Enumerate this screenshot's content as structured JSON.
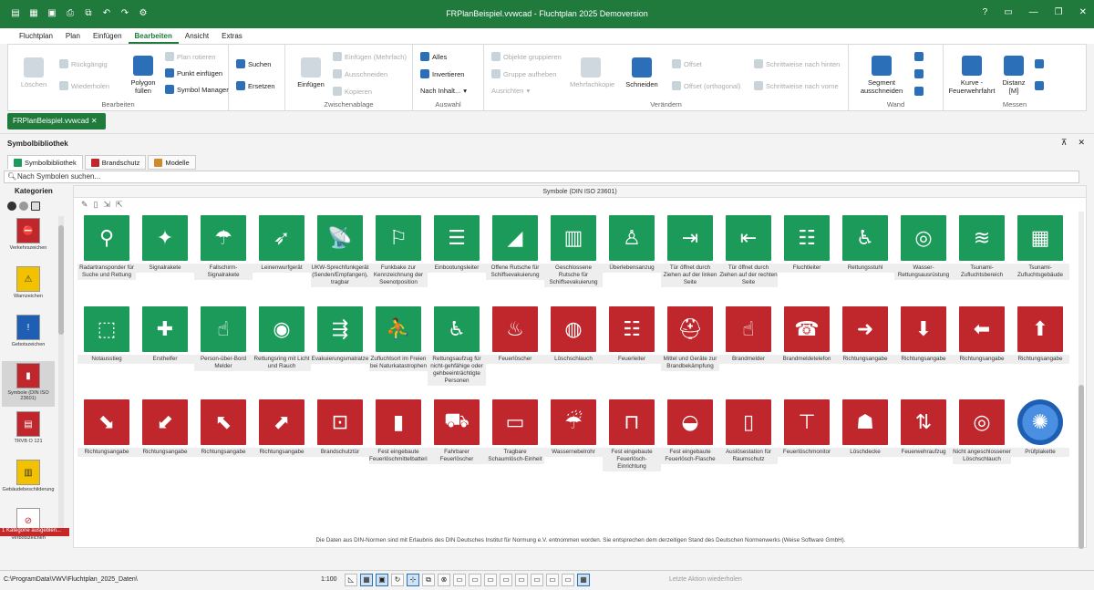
{
  "window": {
    "title": "FRPlanBeispiel.vvwcad - Fluchtplan 2025 Demoversion"
  },
  "menu": [
    "Fluchtplan",
    "Plan",
    "Einfügen",
    "Bearbeiten",
    "Ansicht",
    "Extras"
  ],
  "menu_active": "Bearbeiten",
  "ribbon": {
    "delete": "Löschen",
    "undo": "Rückgängig",
    "redo": "Wiederholen",
    "polygon": "Polygon füllen",
    "plan_rotate": "Plan rotieren",
    "point_insert": "Punkt einfügen",
    "symbol_manager": "Symbol Manager",
    "group_bearbeiten": "Bearbeiten",
    "search": "Suchen",
    "replace": "Ersetzen",
    "paste": "Einfügen",
    "paste_multi": "Einfügen (Mehrfach)",
    "cut": "Ausschneiden",
    "copy": "Kopieren",
    "group_clip": "Zwischenablage",
    "all": "Alles",
    "invert": "Invertieren",
    "by_content": "Nach Inhalt...",
    "group_select": "Auswahl",
    "group_objects": "Objekte gruppieren",
    "ungroup": "Gruppe aufheben",
    "align": "Ausrichten",
    "multi_copy": "Mehrfachkopie",
    "trim": "Schneiden",
    "offset": "Offset",
    "offset_orth": "Offset (orthogonal)",
    "step_back": "Schrittweise nach hinten",
    "step_front": "Schrittweise nach vorne",
    "group_change": "Verändern",
    "segment_cut": "Segment ausschneiden",
    "group_wall": "Wand",
    "curve": "Kurve - Feuerwehrfahrt",
    "distance": "Distanz [M]",
    "group_measure": "Messen"
  },
  "doc_tab": "FRPlanBeispiel.vvwcad",
  "panel": {
    "title": "Symbolbibliothek",
    "tabs": [
      "Symbolbibliothek",
      "Brandschutz",
      "Modelle"
    ],
    "search_placeholder": "Nach Symbolen suchen..."
  },
  "categories": {
    "heading": "Kategorien",
    "items": [
      "Verkehrszeichen",
      "Warnzeichen",
      "Gebotszeichen",
      "Symbole (DIN ISO 23601)",
      "TRVB O 121",
      "Gebäudebeschilderung",
      "Verbotszeichen"
    ],
    "selected": "Symbole (DIN ISO 23601)",
    "hidden_note": "1 Kategorie ausgeblen..."
  },
  "main_header": "Symbole (DIN ISO 23601)",
  "symbols": [
    {
      "label": "Radartransponder für Suche und Rettung",
      "color": "g",
      "glyph": "⚲"
    },
    {
      "label": "Signalrakete",
      "color": "g",
      "glyph": "✦"
    },
    {
      "label": "Fallschirm-Signalrakete",
      "color": "g",
      "glyph": "☂"
    },
    {
      "label": "Leinenwurfgerät",
      "color": "g",
      "glyph": "➶"
    },
    {
      "label": "UKW-Sprechfunkgerät (Senden/Empfangen), tragbar",
      "color": "g",
      "glyph": "📡"
    },
    {
      "label": "Funkbake zur Kennzeichnung der Seenotposition",
      "color": "g",
      "glyph": "⚐"
    },
    {
      "label": "Einbootungsleiter",
      "color": "g",
      "glyph": "☰"
    },
    {
      "label": "Offene Rutsche für Schiffsevakuierung",
      "color": "g",
      "glyph": "◢"
    },
    {
      "label": "Geschlossene Rutsche für Schiffsevakuierung",
      "color": "g",
      "glyph": "▥"
    },
    {
      "label": "Überlebensanzug",
      "color": "g",
      "glyph": "♙"
    },
    {
      "label": "Tür öffnet durch Ziehen auf der linken Seite",
      "color": "g",
      "glyph": "⇥"
    },
    {
      "label": "Tür öffnet durch Ziehen auf der rechten Seite",
      "color": "g",
      "glyph": "⇤"
    },
    {
      "label": "Fluchtleiter",
      "color": "g",
      "glyph": "☷"
    },
    {
      "label": "Rettungsstuhl",
      "color": "g",
      "glyph": "♿"
    },
    {
      "label": "Wasser-Rettungsausrüstung",
      "color": "g",
      "glyph": "◎"
    },
    {
      "label": "Tsunami-Zufluchtsbereich",
      "color": "g",
      "glyph": "≋"
    },
    {
      "label": "Tsunami-Zufluchtsgebäude",
      "color": "g",
      "glyph": "▦"
    },
    {
      "label": "Notausstieg",
      "color": "g",
      "glyph": "⬚"
    },
    {
      "label": "Ersthelfer",
      "color": "g",
      "glyph": "✚"
    },
    {
      "label": "Person-über-Bord Melder",
      "color": "g",
      "glyph": "☝"
    },
    {
      "label": "Rettungsring mit Licht und Rauch",
      "color": "g",
      "glyph": "◉"
    },
    {
      "label": "Evakuierungsmatratze",
      "color": "g",
      "glyph": "⇶"
    },
    {
      "label": "Zufluchtsort im Freien bei Naturkatastrophen",
      "color": "g",
      "glyph": "⛹"
    },
    {
      "label": "Rettungsaufzug für nicht-gehfähige oder gehbeeinträchtigte Personen",
      "color": "g",
      "glyph": "♿"
    },
    {
      "label": "Feuerlöscher",
      "color": "r",
      "glyph": "♨"
    },
    {
      "label": "Löschschlauch",
      "color": "r",
      "glyph": "◍"
    },
    {
      "label": "Feuerleiter",
      "color": "r",
      "glyph": "☷"
    },
    {
      "label": "Mittel und Geräte zur Brandbekämpfung",
      "color": "r",
      "glyph": "⛑"
    },
    {
      "label": "Brandmelder",
      "color": "r",
      "glyph": "☝"
    },
    {
      "label": "Brandmeldetelefon",
      "color": "r",
      "glyph": "☎"
    },
    {
      "label": "Richtungsangabe",
      "color": "r",
      "glyph": "➜"
    },
    {
      "label": "Richtungsangabe",
      "color": "r",
      "glyph": "⬇"
    },
    {
      "label": "Richtungsangabe",
      "color": "r",
      "glyph": "⬅"
    },
    {
      "label": "Richtungsangabe",
      "color": "r",
      "glyph": "⬆"
    },
    {
      "label": "Richtungsangabe",
      "color": "r",
      "glyph": "⬊"
    },
    {
      "label": "Richtungsangabe",
      "color": "r",
      "glyph": "⬋"
    },
    {
      "label": "Richtungsangabe",
      "color": "r",
      "glyph": "⬉"
    },
    {
      "label": "Richtungsangabe",
      "color": "r",
      "glyph": "⬈"
    },
    {
      "label": "Brandschutztür",
      "color": "r",
      "glyph": "⊡"
    },
    {
      "label": "Fest eingebaute Feuerlöschmittelbatterie",
      "color": "r",
      "glyph": "▮"
    },
    {
      "label": "Fahrbarer Feuerlöscher",
      "color": "r",
      "glyph": "⛟"
    },
    {
      "label": "Tragbare Schaumlösch-Einheit",
      "color": "r",
      "glyph": "▭"
    },
    {
      "label": "Wassernebelrohr",
      "color": "r",
      "glyph": "☔"
    },
    {
      "label": "Fest eingebaute Feuerlösch-Einrichtung",
      "color": "r",
      "glyph": "⊓"
    },
    {
      "label": "Fest eingebaute Feuerlösch-Flasche",
      "color": "r",
      "glyph": "◒"
    },
    {
      "label": "Auslösestation für Raumschutz",
      "color": "r",
      "glyph": "▯"
    },
    {
      "label": "Feuerlöschmonitor",
      "color": "r",
      "glyph": "⊤"
    },
    {
      "label": "Löschdecke",
      "color": "r",
      "glyph": "☗"
    },
    {
      "label": "Feuerwehraufzug",
      "color": "r",
      "glyph": "⇅"
    },
    {
      "label": "Nicht angeschlossener Löschschlauch",
      "color": "r",
      "glyph": "◎"
    },
    {
      "label": "Prüfplakette",
      "color": "p",
      "glyph": "✺"
    }
  ],
  "footer_note": "Die Daten aus DIN-Normen sind mit Erlaubnis des DIN Deutsches Institut für Normung e.V. entnommen worden. Sie entsprechen dem derzeitigen Stand des Deutschen Normenwerks (Weise Software GmbH).",
  "status": {
    "path": "C:\\ProgramData\\VWV\\Fluchtplan_2025_Daten\\",
    "zoom": "1:100",
    "last_action": "Letzte Aktion wiederholen"
  },
  "colors": {
    "green": "#1b9a5a",
    "red": "#c0272d",
    "brand": "#1f7a3c"
  }
}
